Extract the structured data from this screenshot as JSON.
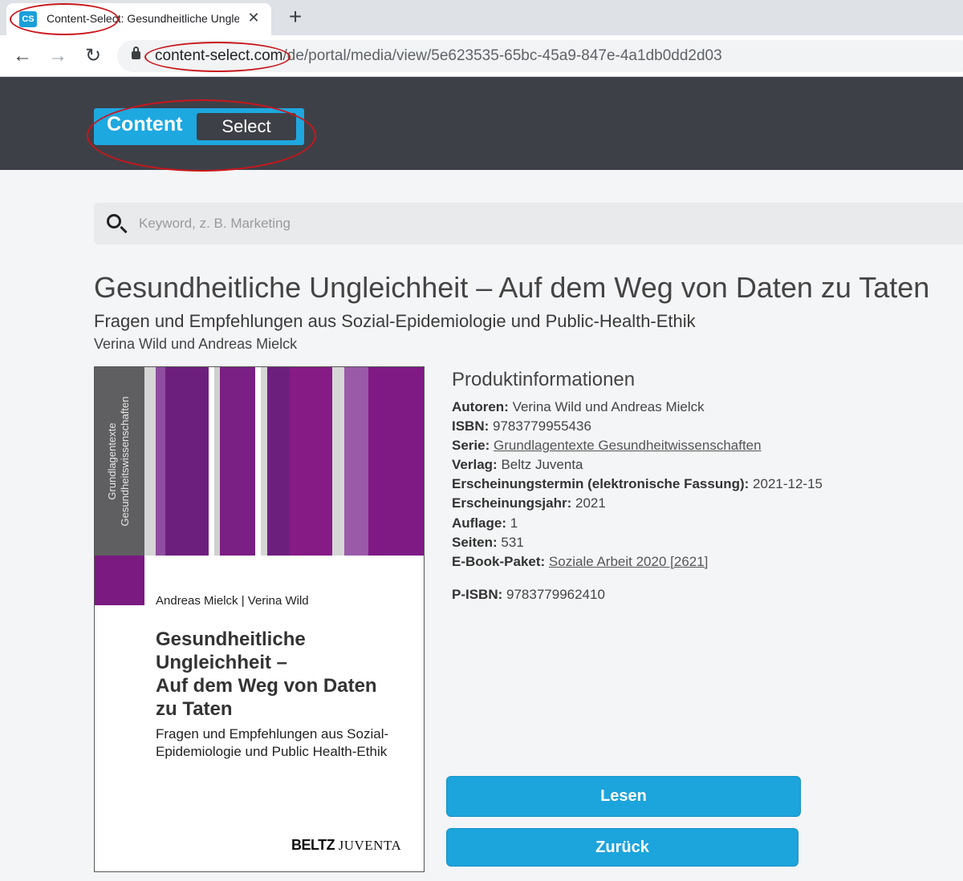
{
  "browser": {
    "tab_icon_text": "CS",
    "tab_title": "Content-Select: Gesundheitliche Ungleichheit",
    "url_host": "content-select.com",
    "url_path": "/de/portal/media/view/5e623535-65bc-45a9-847e-4a1db0dd2d03"
  },
  "logo": {
    "part1": "Content",
    "part2": "Select"
  },
  "search": {
    "placeholder": "Keyword, z. B. Marketing"
  },
  "book": {
    "title": "Gesundheitliche Ungleichheit – Auf dem Weg von Daten zu Taten",
    "subtitle": "Fragen und Empfehlungen aus Sozial-Epidemiologie und Public-Health-Ethik",
    "authors": "Verina Wild und Andreas Mielck"
  },
  "cover": {
    "series_line1": "Grundlagentexte",
    "series_line2": "Gesundheitswissenschaften",
    "authors": "Andreas Mielck | Verina Wild",
    "title": "Gesundheitliche\nUngleichheit –\nAuf dem Weg von Daten\nzu Taten",
    "subtitle": "Fragen und Empfehlungen aus Sozial-\nEpidemiologie und Public Health-Ethik",
    "publisher_1": "BELTZ",
    "publisher_2": "JUVENTA"
  },
  "product_info": {
    "heading": "Produktinformationen",
    "rows": [
      {
        "label": "Autoren:",
        "value": "Verina Wild und Andreas Mielck"
      },
      {
        "label": "ISBN:",
        "value": "9783779955436"
      },
      {
        "label": "Serie:",
        "value": "Grundlagentexte Gesundheitwissenschaften"
      },
      {
        "label": "Verlag:",
        "value": "Beltz Juventa"
      },
      {
        "label": "Erscheinungstermin (elektronische Fassung):",
        "value": "2021-12-15"
      },
      {
        "label": "Erscheinungsjahr:",
        "value": "2021"
      },
      {
        "label": "Auflage:",
        "value": "1"
      },
      {
        "label": "Seiten:",
        "value": "531"
      },
      {
        "label": "E-Book-Paket:",
        "value": "Soziale Arbeit 2020 [2621]"
      }
    ],
    "pisbn_label": "P-ISBN:",
    "pisbn_value": "9783779962410"
  },
  "buttons": {
    "read": "Lesen",
    "back": "Zurück"
  },
  "colors": {
    "header_bg": "#3e4047",
    "accent": "#1ca4dc",
    "annotation": "#c9161c",
    "cover_purple": "#7b1a80"
  }
}
